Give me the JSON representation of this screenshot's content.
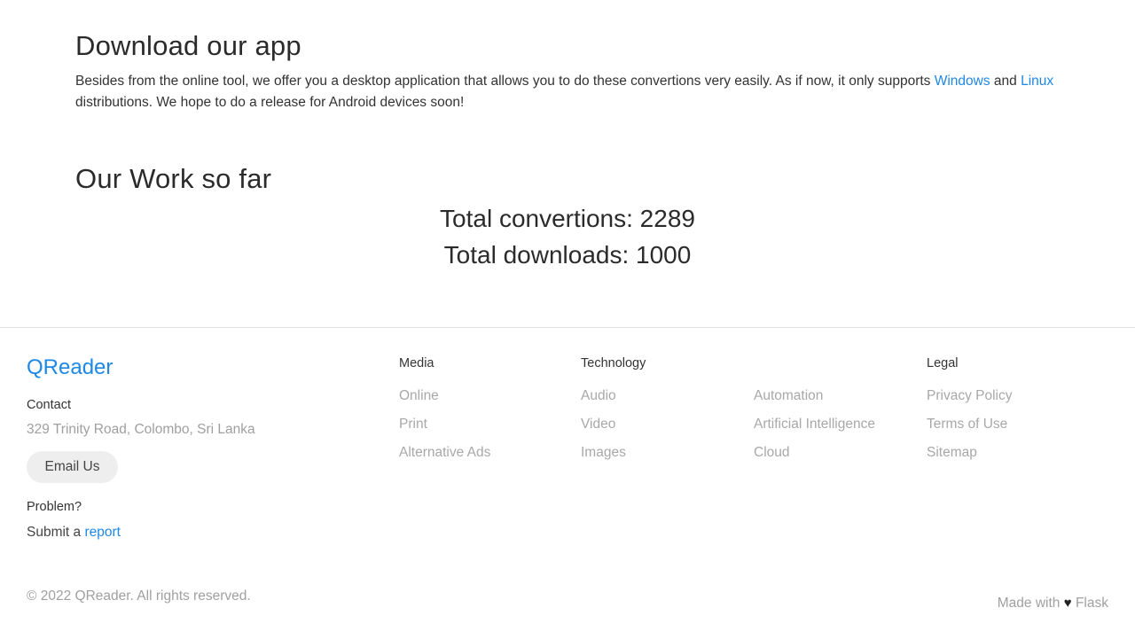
{
  "download": {
    "title": "Download our app",
    "text_before": "Besides from the online tool, we offer you a desktop application that allows you to do these convertions very easily. As if now, it only supports ",
    "link_windows": "Windows",
    "text_and": " and ",
    "link_linux": "Linux",
    "text_after": " distributions. We hope to do a release for Android devices soon!"
  },
  "work": {
    "title": "Our Work so far",
    "conversions": "Total convertions: 2289",
    "downloads": "Total downloads: 1000"
  },
  "footer": {
    "brand": "QReader",
    "contact_label": "Contact",
    "address": "329 Trinity Road, Colombo, Sri Lanka",
    "email_button": "Email Us",
    "problem_label": "Problem?",
    "submit_text": "Submit a ",
    "report_link": "report",
    "columns": [
      {
        "title": "Media",
        "links": [
          "Online",
          "Print",
          "Alternative Ads"
        ]
      },
      {
        "title": "Technology",
        "links": [
          "Audio",
          "Video",
          "Images"
        ]
      },
      {
        "title": "",
        "links": [
          "Automation",
          "Artificial Intelligence",
          "Cloud"
        ]
      },
      {
        "title": "Legal",
        "links": [
          "Privacy Policy",
          "Terms of Use",
          "Sitemap"
        ]
      }
    ],
    "copyright": "© 2022 QReader. All rights reserved.",
    "made_with": "Made with",
    "heart_icon": "♥",
    "made_with_tech": "Flask"
  },
  "colors": {
    "link": "#1e88e5",
    "muted": "#a0a0a0"
  }
}
